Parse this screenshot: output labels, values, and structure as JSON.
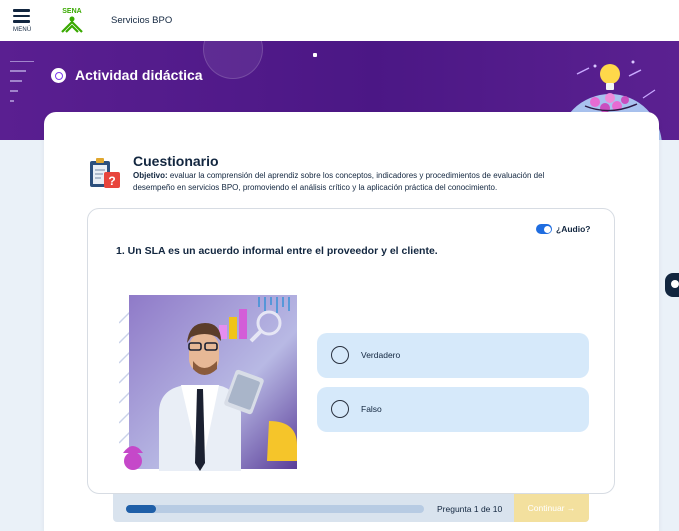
{
  "header": {
    "menu_label": "MENÚ",
    "logo_text": "SENA",
    "app_name": "Servicios BPO",
    "menu_icon": "hamburger-icon",
    "logo_icon": "sena-logo"
  },
  "banner": {
    "title": "Actividad didáctica",
    "icon": "target-icon",
    "art": "lightbulb-illustration"
  },
  "quiz": {
    "icon": "clipboard-question-icon",
    "title": "Cuestionario",
    "objective_label": "Objetivo:",
    "objective_text": "evaluar la comprensión del aprendiz sobre los conceptos, indicadores y procedimientos de evaluación del desempeño en servicios BPO, promoviendo el análisis crítico y la aplicación práctica del conocimiento.",
    "audio_label": "¿Audio?",
    "audio_enabled": true,
    "question": "1. Un SLA es un acuerdo informal entre el proveedor y el cliente.",
    "options": [
      {
        "label": "Verdadero",
        "selected": false
      },
      {
        "label": "Falso",
        "selected": false
      }
    ],
    "image": "businessman-tablet-illustration"
  },
  "footer": {
    "progress_label": "Pregunta 1 de 10",
    "progress_fraction": 0.1,
    "continue_label": "Continuar →"
  },
  "colors": {
    "brand_purple": "#4b1785",
    "accent_blue": "#1f6de0",
    "option_bg": "#d6e9fa",
    "continue_disabled": "#f3e09e",
    "sena_green": "#39a900"
  }
}
